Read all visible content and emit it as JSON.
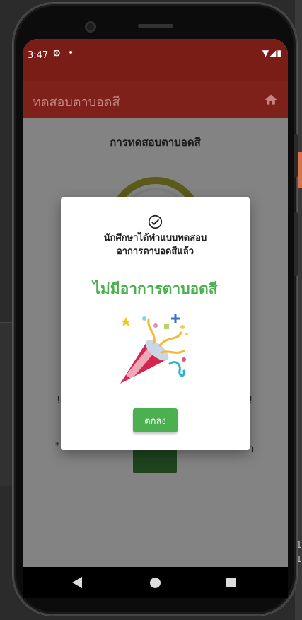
{
  "status_bar": {
    "time": "3:47"
  },
  "app_bar": {
    "title": "ทดสอบตาบอดสี",
    "home_icon": "home-icon"
  },
  "page": {
    "heading": "การทดสอบตาบอดสี",
    "behind_text_left": "!",
    "behind_text_right": "!",
    "behind_text_bottom_left": "*",
    "behind_text_bottom_right": "า"
  },
  "dialog": {
    "icon": "check-circle-icon",
    "message_line1": "นักศึกษาได้ทำแบบทดสอบ",
    "message_line2": "อาการตาบอดสีแล้ว",
    "result": "ไม่มีอาการตาบอดสี",
    "image": "party-popper-icon",
    "ok_label": "ตกลง"
  },
  "editor_bg": {
    "line_no_1": "1",
    "line_no_2": "1"
  },
  "colors": {
    "status_bar": "#7a1d17",
    "app_bar": "#7e211b",
    "result_green": "#4caf50",
    "button_green": "#4caf50"
  }
}
